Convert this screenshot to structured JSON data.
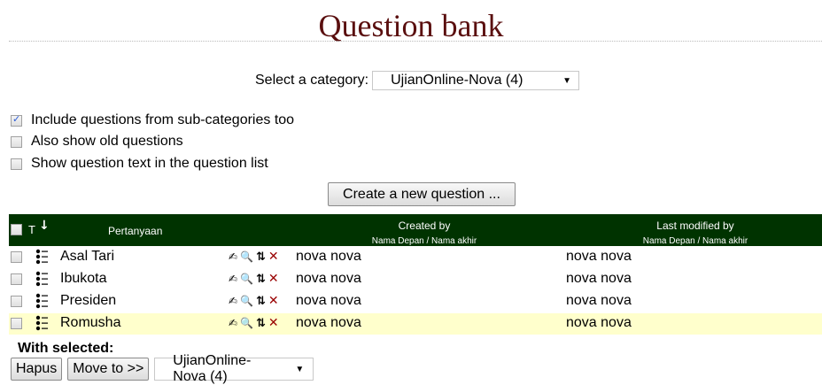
{
  "page": {
    "title": "Question bank"
  },
  "category": {
    "label": "Select a category:",
    "selected": "UjianOnline-Nova (4)"
  },
  "options": [
    {
      "label": "Include questions from sub-categories too",
      "checked": true
    },
    {
      "label": "Also show old questions",
      "checked": false
    },
    {
      "label": "Show question text in the question list",
      "checked": false
    }
  ],
  "create_button": "Create a new question ...",
  "table": {
    "header": {
      "type": "T",
      "sort_icon": "down-arrow",
      "question": "Pertanyaan",
      "created_by": "Created by",
      "created_by_sub": "Nama Depan / Nama akhir",
      "modified_by": "Last modified by",
      "modified_by_sub": "Nama Depan / Nama akhir"
    },
    "rows": [
      {
        "name": "Asal Tari",
        "created": "nova nova",
        "modified": "nova nova",
        "highlight": false
      },
      {
        "name": "Ibukota",
        "created": "nova nova",
        "modified": "nova nova",
        "highlight": false
      },
      {
        "name": "Presiden",
        "created": "nova nova",
        "modified": "nova nova",
        "highlight": false
      },
      {
        "name": "Romusha",
        "created": "nova nova",
        "modified": "nova nova",
        "highlight": true
      }
    ]
  },
  "bulk": {
    "label": "With selected:",
    "delete": "Hapus",
    "move": "Move to >>",
    "target": "UjianOnline-Nova (4)"
  },
  "colors": {
    "title": "#5a0f0f",
    "header_bg": "#003300",
    "highlight_row": "#ffffcc"
  }
}
